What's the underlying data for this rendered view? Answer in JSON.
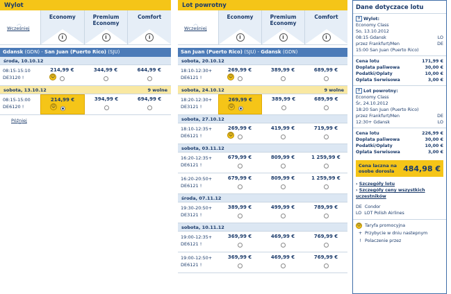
{
  "outbound": {
    "title": "Wylot",
    "classes": [
      "Economy",
      "Premium\nEconomy",
      "Comfort"
    ],
    "earlier": "Wcześniej",
    "later": "Później",
    "route": {
      "from": "Gdansk",
      "from_code": "(GDN)",
      "to": "San Juan (Puerto Rico)",
      "to_code": "(SJU)"
    },
    "days": [
      {
        "label": "środa, 10.10.12",
        "note": "",
        "selected": false,
        "flights": [
          {
            "times": "08:15-15:10",
            "code": "DE3120",
            "prices": [
              "214,99 €",
              "344,99 €",
              "644,99 €"
            ],
            "promo": true,
            "selected_idx": -1
          }
        ]
      },
      {
        "label": "sobota, 13.10.12",
        "note": "9 wolne",
        "selected": true,
        "flights": [
          {
            "times": "08:15-15:00",
            "code": "DE6120",
            "prices": [
              "214,99 €",
              "394,99 €",
              "694,99 €"
            ],
            "promo": true,
            "selected_idx": 0
          }
        ]
      }
    ]
  },
  "return": {
    "title": "Lot powrotny",
    "classes": [
      "Economy",
      "Premium\nEconomy",
      "Comfort"
    ],
    "earlier": "Wcześniej",
    "route": {
      "from": "San Juan (Puerto Rico)",
      "from_code": "(SJU)",
      "to": "Gdansk",
      "to_code": "(GDN)"
    },
    "days": [
      {
        "label": "sobota, 20.10.12",
        "note": "",
        "selected": false,
        "flights": [
          {
            "times": "18:10-12:30+",
            "code": "DE6121",
            "prices": [
              "269,99 €",
              "389,99 €",
              "689,99 €"
            ],
            "promo": true,
            "selected_idx": -1
          }
        ]
      },
      {
        "label": "sobota, 24.10.12",
        "note": "9 wolne",
        "selected": true,
        "flights": [
          {
            "times": "18:20-12:30+",
            "code": "DE3121",
            "prices": [
              "269,99 €",
              "389,99 €",
              "689,99 €"
            ],
            "promo": true,
            "selected_idx": 0
          }
        ]
      },
      {
        "label": "sobota, 27.10.12",
        "note": "",
        "selected": false,
        "flights": [
          {
            "times": "18:10-12:35+",
            "code": "DE6121",
            "prices": [
              "269,99 €",
              "419,99 €",
              "719,99 €"
            ],
            "promo": true,
            "selected_idx": -1
          }
        ]
      },
      {
        "label": "sobota, 03.11.12",
        "note": "",
        "selected": false,
        "flights": [
          {
            "times": "16:20-12:35+",
            "code": "DE6121",
            "prices": [
              "679,99 €",
              "809,99 €",
              "1 259,99 €"
            ],
            "promo": false,
            "selected_idx": -1
          },
          {
            "times": "16:20-20:50+",
            "code": "DE6121",
            "prices": [
              "679,99 €",
              "809,99 €",
              "1 259,99 €"
            ],
            "promo": false,
            "selected_idx": -1
          }
        ]
      },
      {
        "label": "środa, 07.11.12",
        "note": "",
        "selected": false,
        "flights": [
          {
            "times": "19:30-20:50+",
            "code": "DE3121",
            "prices": [
              "389,99 €",
              "499,99 €",
              "789,99 €"
            ],
            "promo": false,
            "selected_idx": -1
          }
        ]
      },
      {
        "label": "sobota, 10.11.12",
        "note": "",
        "selected": false,
        "flights": [
          {
            "times": "19:00-12:35+",
            "code": "DE6121",
            "prices": [
              "369,99 €",
              "469,99 €",
              "769,99 €"
            ],
            "promo": false,
            "selected_idx": -1
          },
          {
            "times": "19:00-12:50+",
            "code": "DE6121",
            "prices": [
              "369,99 €",
              "469,99 €",
              "769,99 €"
            ],
            "promo": false,
            "selected_idx": -1
          }
        ]
      }
    ]
  },
  "sidebar": {
    "title": "Dane dotyczace lotu",
    "outbound": {
      "label": "Wylot:",
      "class": "Economy Class",
      "date": "So, 13.10.2012",
      "dep": "08:15 Gdansk",
      "dep_carrier": "LO",
      "via": "przez Frankfurt/Men",
      "via_carrier": "DE",
      "arr": "15:00 San Juan (Puerto Rico)"
    },
    "costs1": [
      [
        "Cena lotu",
        "171,99 €"
      ],
      [
        "Doplata paliwowa",
        "30,00 €"
      ],
      [
        "Podatki/Oplaty",
        "10,00 €"
      ],
      [
        "Oplata Serwisowa",
        "3,00 €"
      ]
    ],
    "ret": {
      "label": "Lot powrotny:",
      "class": "Economy Class",
      "date": "Śr, 24.10.2012",
      "dep": "18:20 San Juan (Puerto Rico)",
      "via": "przez Frankfurt/Men",
      "via_carrier": "DE",
      "arr": "12:30+ Gdansk",
      "arr_carrier": "LO"
    },
    "costs2": [
      [
        "Cena lotu",
        "226,99 €"
      ],
      [
        "Doplata paliwowa",
        "30,00 €"
      ],
      [
        "Podatki/Oplaty",
        "10,00 €"
      ],
      [
        "Oplata Serwisowa",
        "3,00 €"
      ]
    ],
    "total_label": "Cena laczna na osobe dorosla",
    "total": "484,98 €",
    "links": [
      "Szczegóły lotu",
      "Szczegóły ceny wszystkich uczestników"
    ],
    "carriers": [
      [
        "DE",
        "Condor"
      ],
      [
        "LO",
        "LOT Polish Airlines"
      ]
    ],
    "legend": [
      "Taryfa promocyjna",
      "Przybycie w dniu nastepnym",
      "Polaczenie przez"
    ]
  }
}
